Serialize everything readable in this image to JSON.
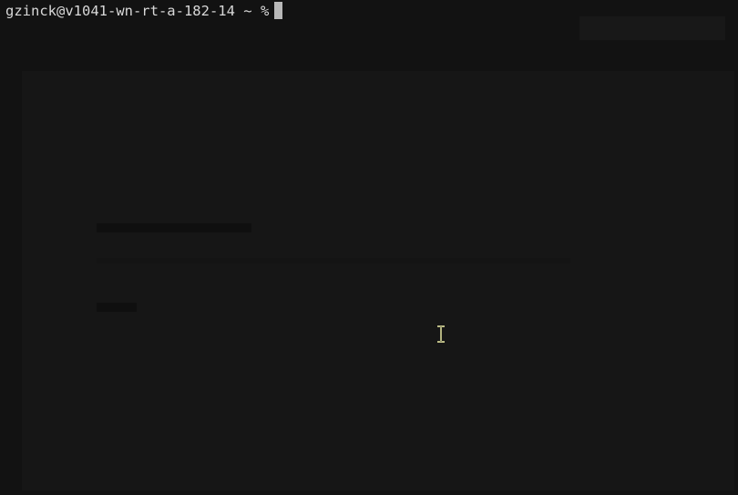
{
  "terminal": {
    "prompt": "gzinck@v1041-wn-rt-a-182-14 ~ %"
  }
}
